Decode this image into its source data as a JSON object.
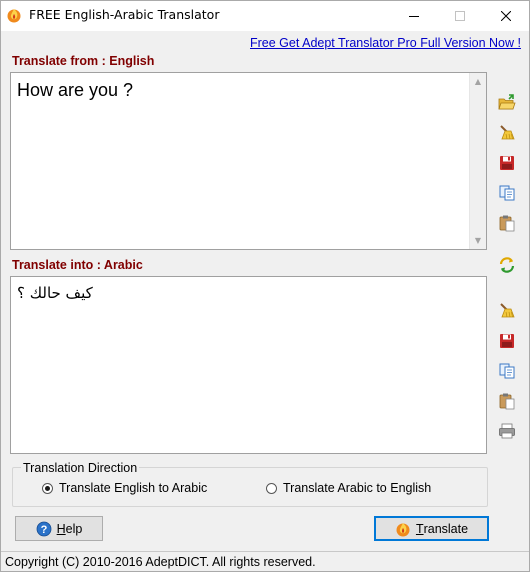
{
  "window": {
    "title": "FREE English-Arabic Translator",
    "controls": {
      "minimize": "minimize-icon",
      "maximize": "maximize-icon",
      "close": "close-icon"
    }
  },
  "promo_link": "Free Get Adept Translator Pro Full Version Now !",
  "source": {
    "label": "Translate from : English",
    "text": "How are you ?",
    "tools": [
      "open-folder-icon",
      "clear-broom-icon",
      "save-disk-icon",
      "copy-icon",
      "paste-icon"
    ]
  },
  "swap_tool": "swap-refresh-icon",
  "target": {
    "label": "Translate into : Arabic",
    "text": "كيف حالك ؟",
    "tools": [
      "clear-broom-icon",
      "save-disk-icon",
      "copy-icon",
      "paste-icon",
      "print-icon"
    ]
  },
  "direction": {
    "title": "Translation Direction",
    "options": [
      {
        "label": "Translate English to Arabic",
        "selected": true
      },
      {
        "label": "Translate Arabic to English",
        "selected": false
      }
    ]
  },
  "buttons": {
    "help_prefix": "H",
    "help_rest": "elp",
    "translate_prefix": "T",
    "translate_rest": "ranslate"
  },
  "status": "Copyright (C) 2010-2016 AdeptDICT. All rights reserved.",
  "colors": {
    "label": "#800000",
    "link": "#0000c8",
    "accent": "#0078d7"
  }
}
